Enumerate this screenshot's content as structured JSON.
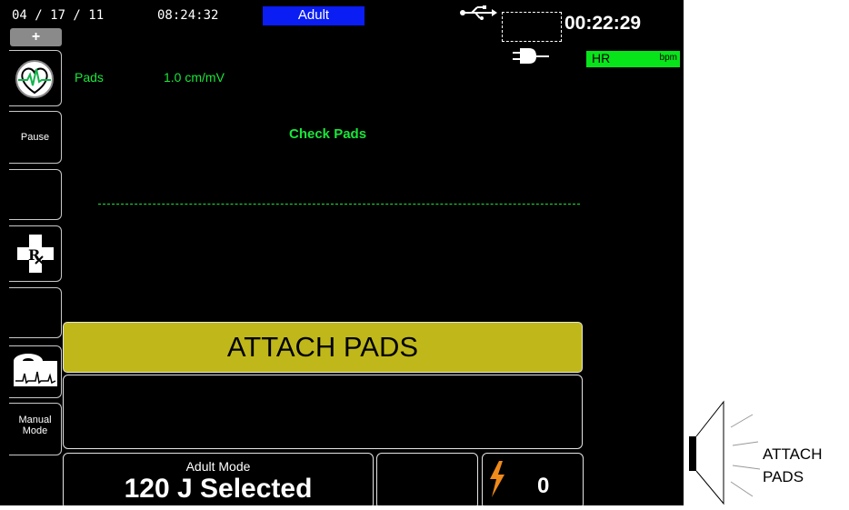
{
  "header": {
    "date": "04 / 17 / 11",
    "time": "08:24:32",
    "mode_badge": "Adult",
    "elapsed": "00:22:29",
    "mode_badge_color": "#0a1df2"
  },
  "vitals": {
    "hr_label": "HR",
    "hr_unit": "bpm",
    "hr_box_color": "#08e41a"
  },
  "sidebar": {
    "plus_label": "+",
    "buttons": [
      {
        "label": "",
        "icon": "ecg-heart-icon"
      },
      {
        "label": "Pause",
        "icon": ""
      },
      {
        "label": "",
        "icon": ""
      },
      {
        "label": "",
        "icon": "rx-cross-icon"
      },
      {
        "label": "",
        "icon": ""
      },
      {
        "label": "",
        "icon": "recorder-icon"
      },
      {
        "label_line1": "Manual",
        "label_line2": "Mode",
        "icon": ""
      }
    ]
  },
  "waveform": {
    "lead": "Pads",
    "gain": "1.0 cm/mV",
    "status": "Check Pads",
    "trace_color": "#19e63a"
  },
  "prompt": {
    "text": "ATTACH PADS",
    "bar_color": "#c0b81a"
  },
  "energy": {
    "mode": "Adult Mode",
    "selected": "120 J Selected"
  },
  "shock": {
    "count": "0",
    "icon": "lightning-bolt-icon"
  },
  "voice_prompt": {
    "line1": "ATTACH",
    "line2": "PADS",
    "icon": "speaker-icon"
  }
}
